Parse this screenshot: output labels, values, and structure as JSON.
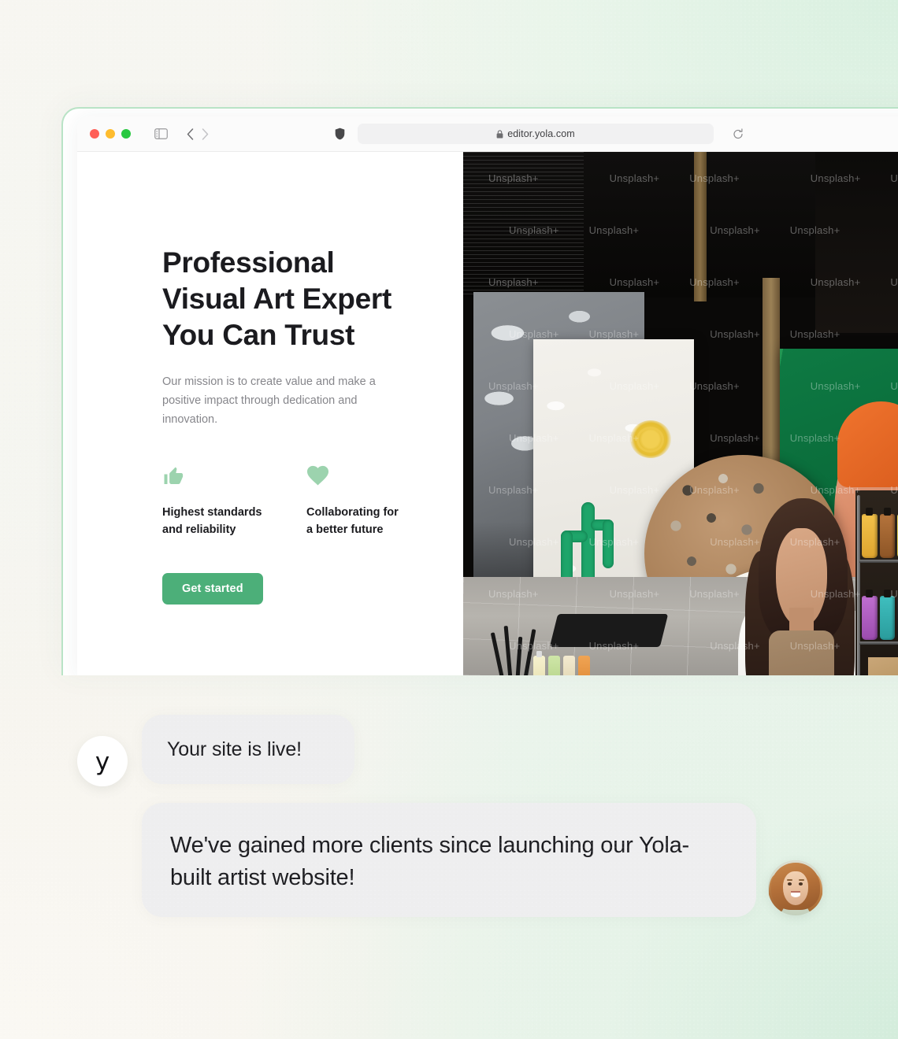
{
  "browser": {
    "traffic_lights": [
      "close",
      "minimize",
      "maximize"
    ],
    "sidebar_toggle_label": "Show sidebar",
    "back_label": "Back",
    "forward_label": "Forward",
    "shield_label": "Privacy report",
    "lock_label": "Secure connection",
    "url": "editor.yola.com",
    "reload_label": "Reload page"
  },
  "hero": {
    "headline": "Professional\nVisual Art Expert\nYou Can Trust",
    "subtext": "Our mission is to create value and make a positive impact through dedication and innovation.",
    "features": [
      {
        "icon": "thumbs-up-icon",
        "text": "Highest standards\nand reliability"
      },
      {
        "icon": "heart-icon",
        "text": "Collaborating for\na better future"
      }
    ],
    "cta_label": "Get started",
    "image_alt": "Artist seated in studio surrounded by paintings and paint supplies",
    "image_watermark": "Unsplash+"
  },
  "chat": {
    "brand_logo_letter": "y",
    "messages": [
      {
        "from": "yola",
        "text": "Your site is live!"
      },
      {
        "from": "user",
        "text": "We've gained more clients since launching our Yola-built artist website!"
      }
    ],
    "user_avatar_alt": "Smiling woman with auburn hair"
  },
  "colors": {
    "accent_green": "#4caf79",
    "icon_green": "#9cd3ae",
    "window_border": "#b9e3c6",
    "bubble_bg": "#eeeeef",
    "text_dark": "#1b1b1f",
    "text_muted": "#86868b"
  }
}
